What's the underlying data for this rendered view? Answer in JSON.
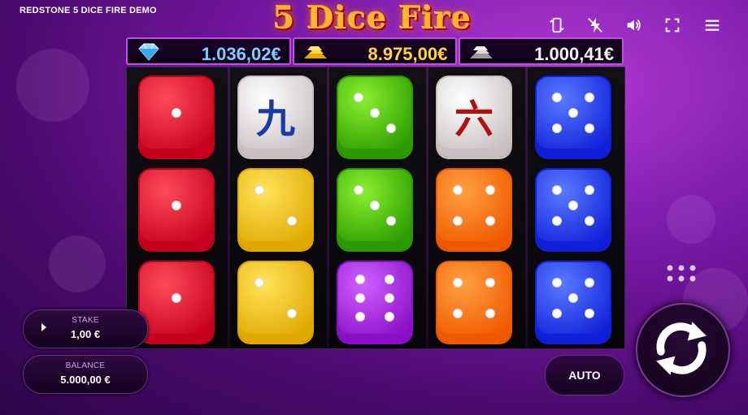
{
  "topbar": {
    "brand": "REDSTONE",
    "game_name": "5 DICE FIRE",
    "mode": "DEMO"
  },
  "logo": {
    "text": "5 Dice Fire"
  },
  "controls": {
    "icons": [
      "rotate-screen-icon",
      "turbo-off-icon",
      "sound-icon",
      "fullscreen-icon",
      "menu-icon"
    ]
  },
  "jackpots": [
    {
      "icon": "diamond-icon",
      "value": "1.036,02€",
      "color": "#7ecbff"
    },
    {
      "icon": "gold-bars-icon",
      "value": "8.975,00€",
      "color": "#ffd53a"
    },
    {
      "icon": "silver-bars-icon",
      "value": "1.000,41€",
      "color": "#f2f2f2"
    }
  ],
  "reels": [
    [
      {
        "type": "pips",
        "color": "red",
        "pips": 1
      },
      {
        "type": "pips",
        "color": "red",
        "pips": 1
      },
      {
        "type": "pips",
        "color": "red",
        "pips": 1
      }
    ],
    [
      {
        "type": "kanji",
        "char": "九",
        "kanji_color": "#1a3aa8"
      },
      {
        "type": "pips",
        "color": "yellow",
        "pips": 2
      },
      {
        "type": "pips",
        "color": "yellow",
        "pips": 2
      }
    ],
    [
      {
        "type": "pips",
        "color": "green",
        "pips": 3
      },
      {
        "type": "pips",
        "color": "green",
        "pips": 3
      },
      {
        "type": "pips",
        "color": "purple",
        "pips": 6
      }
    ],
    [
      {
        "type": "kanji",
        "char": "六",
        "kanji_color": "#b01010"
      },
      {
        "type": "pips",
        "color": "orange",
        "pips": 4
      },
      {
        "type": "pips",
        "color": "orange",
        "pips": 4
      }
    ],
    [
      {
        "type": "pips",
        "color": "blue",
        "pips": 5
      },
      {
        "type": "pips",
        "color": "blue",
        "pips": 5
      },
      {
        "type": "pips",
        "color": "blue",
        "pips": 5
      }
    ]
  ],
  "die_colors": {
    "red": [
      "#ff4a5a",
      "#c4001c"
    ],
    "yellow": [
      "#ffe45a",
      "#e0a800"
    ],
    "green": [
      "#8af02e",
      "#2a9a00"
    ],
    "orange": [
      "#ffa040",
      "#f05800"
    ],
    "blue": [
      "#5a7aff",
      "#1020d8"
    ],
    "purple": [
      "#d060ff",
      "#8a10c8"
    ],
    "white": [
      "#ffffff",
      "#c8c0c0"
    ]
  },
  "stake": {
    "label": "STAKE",
    "value": "1,00 €"
  },
  "balance": {
    "label": "BALANCE",
    "value": "5.000,00 €"
  },
  "auto_label": "AUTO",
  "spin": {
    "icon": "spin-icon"
  },
  "options": {
    "icon": "dots-grid-icon"
  }
}
